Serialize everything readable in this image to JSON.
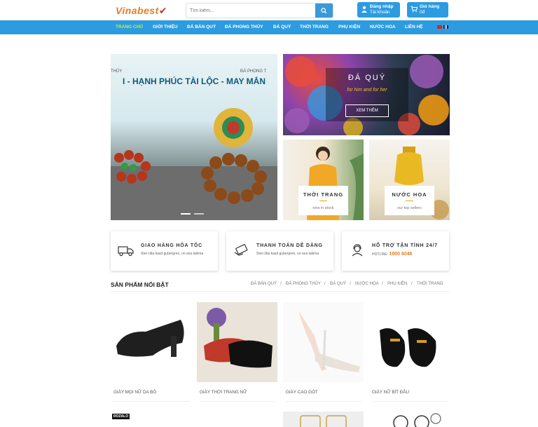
{
  "header": {
    "logo": "Vinabest",
    "search_placeholder": "Tìm kiếm...",
    "login": {
      "line1": "Đăng nhập",
      "line2": "Tài khoản"
    },
    "cart": {
      "line1": "Giỏ hàng",
      "line2": "0đ"
    }
  },
  "nav": {
    "items": [
      "Trang chủ",
      "Giới thiệu",
      "Đá bán quý",
      "Đá phong thủy",
      "Đá quý",
      "Thời trang",
      "Phụ kiện",
      "Nước hoa",
      "Liên hệ"
    ],
    "active_index": 0
  },
  "hero": {
    "main_tag_left": "THỦY",
    "main_tag_right": "ĐÁ PHONG T",
    "main_banner": "I - HẠNH PHÚC TÀI LỘC - MAY MẮN",
    "gem_title": "ĐÁ QUÝ",
    "gem_sub": "for him and for her",
    "gem_button": "XEM THÊM",
    "fashion_title": "THỜI TRANG",
    "fashion_sub": "new in stock",
    "perfume_title": "NƯỚC HOA",
    "perfume_sub": "our top sellers"
  },
  "services": [
    {
      "title": "GIAO HÀNG HỎA TỐC",
      "desc": "Stet clita kasd gubergren, no sea takima",
      "icon": "truck-icon"
    },
    {
      "title": "THANH TOÁN DỄ DÀNG",
      "desc": "Stet clita kasd gubergren, no sea takima",
      "icon": "card-payment-icon"
    },
    {
      "title": "HỖ TRỢ TẬN TÌNH 24/7",
      "hotline_label": "HOTLINE:",
      "hotline": "1900 6046",
      "icon": "support-icon"
    }
  ],
  "featured": {
    "title": "SẢN PHẨM NỔI BẬT",
    "tabs": [
      "ĐÁ BÁN QUÝ",
      "ĐÁ PHONG THỦY",
      "ĐÁ QUÝ",
      "NƯỚC HOA",
      "PHỤ KIỆN",
      "THỜI TRANG"
    ],
    "separator": "/",
    "products": [
      "GIÀY MỌI NỮ DA BÒ",
      "GIÀY THỜI TRANG NỮ",
      "GIÀY CAO GÓT",
      "GIÀY NỮ BÍT ĐẦU"
    ]
  },
  "zalo": "ROZALO",
  "colors": {
    "primary": "#2d9be0",
    "accent": "#e67e22",
    "nav_active": "#b9f24a"
  }
}
